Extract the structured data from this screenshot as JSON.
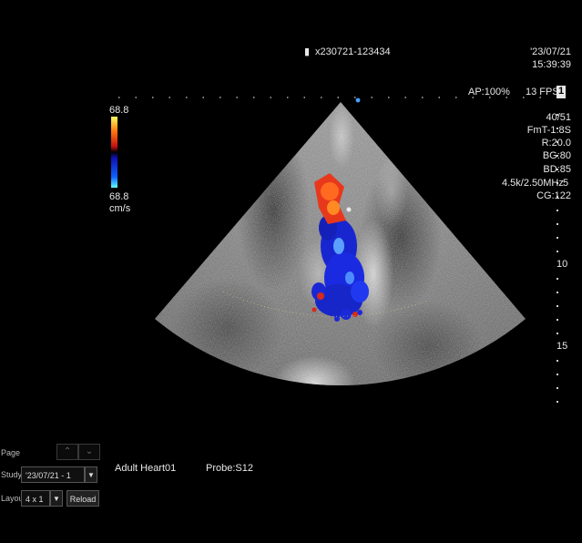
{
  "header": {
    "patient_id": "x230721-123434",
    "date": "'23/07/21",
    "time": "15:39:39",
    "ap": "AP:100%",
    "fps": "13 FPS",
    "fps_marker": "1"
  },
  "color_scale": {
    "max": "68.8",
    "min": "68.8",
    "unit": "cm/s"
  },
  "params": {
    "p1": "40/51",
    "p2": "FmT-1.8S",
    "p3": "R:20.0",
    "p4": "BG:80",
    "p5": "BD:85",
    "p6": "4.5k/2.50MHz",
    "p7": "CG:122"
  },
  "depth_scale": {
    "mark_5": "5",
    "mark_10": "10",
    "mark_15": "15"
  },
  "footer": {
    "preset": "Adult Heart01",
    "probe": "Probe:S12"
  },
  "controls": {
    "page_label": "Page",
    "study_label": "Study",
    "study_value": "'23/07/21 - 1",
    "layout_label": "Layout",
    "layout_value": "4 x 1",
    "reload_label": "Reload",
    "up_arrow": "⌃",
    "down_arrow": "⌄",
    "dropdown_arrow": "▼"
  },
  "colors": {
    "background": "#000000",
    "text": "#e8e8e8",
    "flow_toward": "#e8321a",
    "flow_away": "#1a2bd8"
  }
}
